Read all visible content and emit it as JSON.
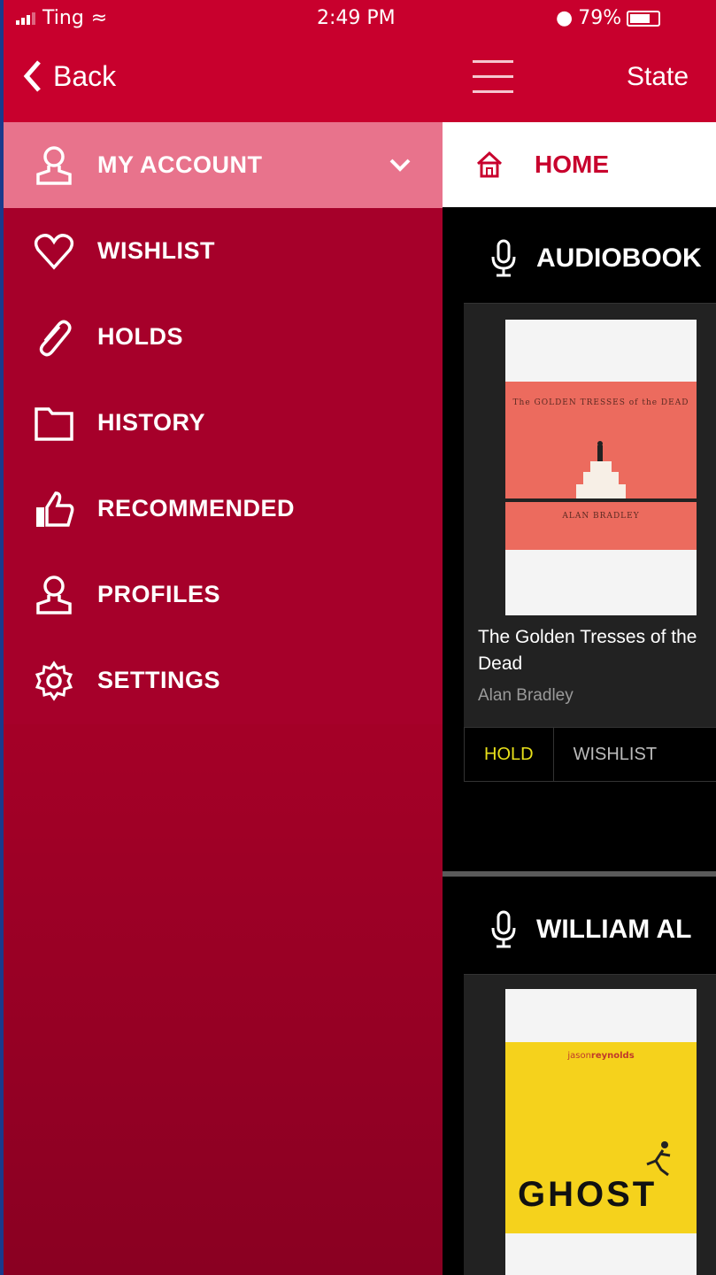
{
  "status_bar": {
    "carrier": "Ting",
    "time": "2:49 PM",
    "battery": "79%"
  },
  "drawer": {
    "back_label": "Back",
    "items": [
      {
        "label": "MY ACCOUNT",
        "icon": "user-icon",
        "active": true
      },
      {
        "label": "WISHLIST",
        "icon": "heart-icon"
      },
      {
        "label": "HOLDS",
        "icon": "paperclip-icon"
      },
      {
        "label": "HISTORY",
        "icon": "folder-icon"
      },
      {
        "label": "RECOMMENDED",
        "icon": "thumbs-up-icon"
      },
      {
        "label": "PROFILES",
        "icon": "user-icon"
      },
      {
        "label": "SETTINGS",
        "icon": "gear-icon"
      }
    ]
  },
  "main": {
    "title": "State",
    "home_label": "HOME",
    "sections": [
      {
        "title": "AUDIOBOOK",
        "book": {
          "title": "The Golden Tresses of the Dead",
          "author": "Alan Bradley",
          "cover_title": "The GOLDEN TRESSES of the DEAD",
          "cover_author": "ALAN BRADLEY"
        },
        "actions": {
          "hold": "HOLD",
          "wishlist": "WISHLIST"
        }
      },
      {
        "title": "WILLIAM AL",
        "book": {
          "cover_author_first": "jason",
          "cover_author_last": "reynolds",
          "cover_title": "GHOST"
        }
      }
    ]
  },
  "colors": {
    "brand_red": "#c8002d",
    "drawer_red": "#a6002a",
    "active_item": "#e8738c",
    "hold_yellow": "#e8e01a"
  }
}
